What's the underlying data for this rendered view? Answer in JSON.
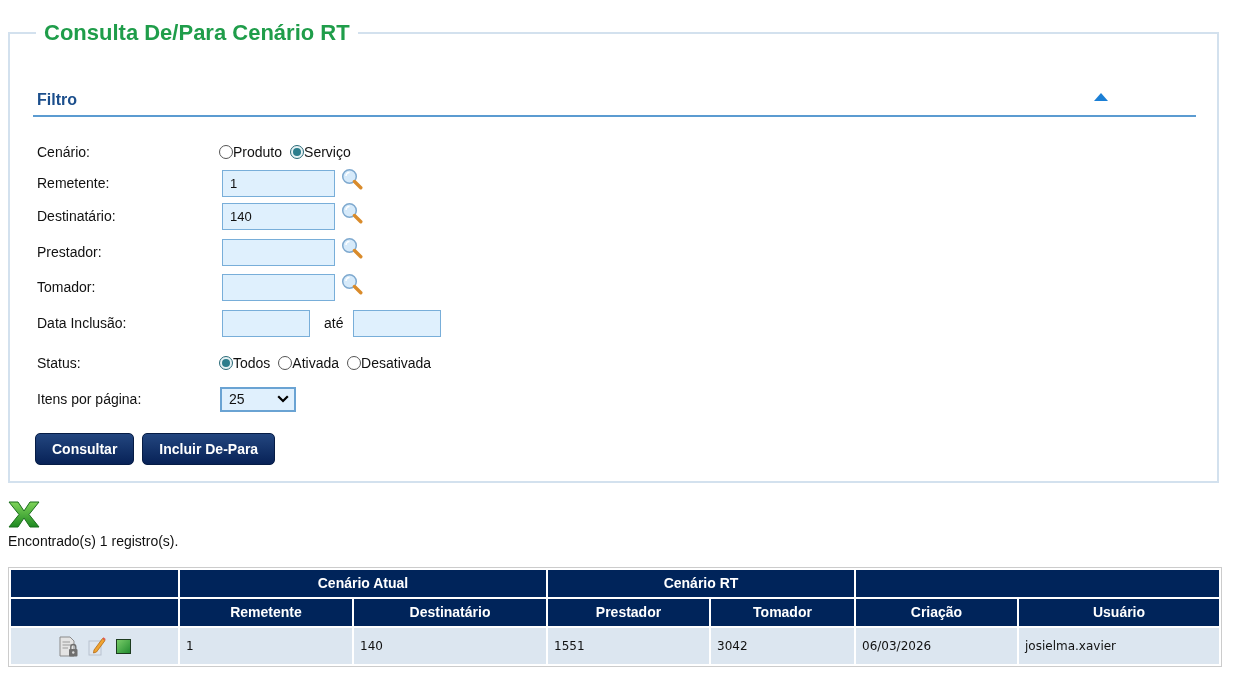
{
  "page": {
    "title": "Consulta De/Para Cenário RT"
  },
  "filter": {
    "title": "Filtro",
    "expanded": true,
    "fields": [
      {
        "kind": "radio",
        "label": "Cenário:",
        "options": [
          {
            "label": "Produto",
            "selected": false
          },
          {
            "label": "Serviço",
            "selected": true
          }
        ]
      },
      {
        "kind": "lookup",
        "label": "Remetente:",
        "value": "1"
      },
      {
        "kind": "lookup",
        "label": "Destinatário:",
        "value": "140"
      },
      {
        "kind": "lookup",
        "label": "Prestador:"
      },
      {
        "kind": "lookup",
        "label": "Tomador:"
      },
      {
        "kind": "date_range",
        "label": "Data Inclusão:",
        "separator": "até"
      },
      {
        "kind": "radio",
        "label": "Status:",
        "options": [
          {
            "label": "Todos",
            "selected": true
          },
          {
            "label": "Ativada",
            "selected": false
          },
          {
            "label": "Desativada",
            "selected": false
          }
        ]
      },
      {
        "kind": "select",
        "label": "Itens por página:",
        "value": "25"
      }
    ],
    "buttons": [
      "Consultar",
      "Incluir De-Para"
    ]
  },
  "results": {
    "summary": "Encontrado(s) 1 registro(s).",
    "table": {
      "column_groups": [
        {
          "kind": "actions"
        },
        {
          "kind": "data",
          "label": "Cenário Atual",
          "columns": [
            "Remetente",
            "Destinatário"
          ]
        },
        {
          "kind": "data",
          "label": "Cenário RT",
          "columns": [
            "Prestador",
            "Tomador"
          ]
        },
        {
          "kind": "data",
          "columns": [
            "Criação",
            "Usuário"
          ]
        }
      ],
      "rows": [
        {
          "cells": [
            "1",
            "140",
            "1551",
            "3042",
            "06/03/2026",
            "josielma.xavier"
          ]
        }
      ]
    }
  }
}
